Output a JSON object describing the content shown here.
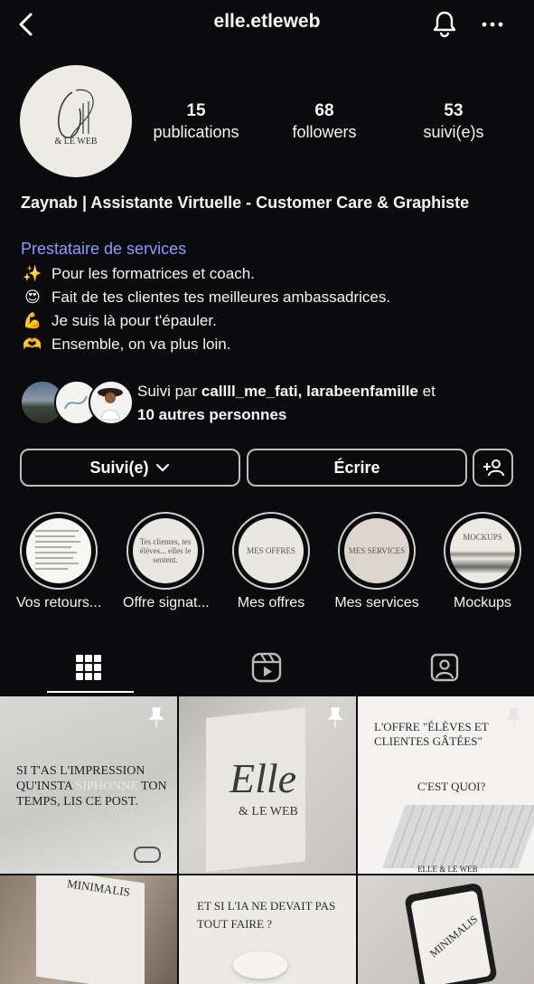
{
  "header": {
    "username": "elle.etleweb"
  },
  "profile": {
    "avatar_logo_text": "Elle",
    "avatar_logo_sub": "& LE WEB",
    "stats": [
      {
        "value": "15",
        "label": "publications"
      },
      {
        "value": "68",
        "label": "followers"
      },
      {
        "value": "53",
        "label": "suivi(e)s"
      }
    ],
    "name": "Zaynab | Assistante Virtuelle - Customer Care & Graphiste",
    "category": "Prestataire de services",
    "bio": [
      {
        "emoji": "✨",
        "text": "Pour les formatrices et coach."
      },
      {
        "emoji": "😍",
        "text": "Fait de tes clientes tes meilleures ambassadrices."
      },
      {
        "emoji": "💪",
        "text": "Je suis là pour t'épauler."
      },
      {
        "emoji": "🫶",
        "text": "Ensemble, on va plus loin."
      }
    ],
    "mutual": {
      "prefix": "Suivi par ",
      "names": "callll_me_fati, larabeenfamille",
      "middle": " et",
      "others": "10 autres personnes"
    }
  },
  "actions": {
    "following_label": "Suivi(e)",
    "message_label": "Écrire"
  },
  "highlights": [
    {
      "label": "Vos retours...",
      "cover": "avis"
    },
    {
      "label": "Offre signat...",
      "cover": "Tes clientes, tes élèves... elles le sentent."
    },
    {
      "label": "Mes offres",
      "cover": "MES OFFRES"
    },
    {
      "label": "Mes services",
      "cover": "MES SERVICES"
    },
    {
      "label": "Mockups",
      "cover": "MOCKUPS"
    }
  ],
  "posts": [
    {
      "text_a": "SI T'AS L'IMPRESSION QU'INSTA ",
      "highlight": "SIPHONNE",
      "text_b": " TON TEMPS, LIS CE POST."
    },
    {
      "logo": "Elle",
      "sub": "& LE WEB"
    },
    {
      "headline": "L'OFFRE \"ÉLÈVES ET CLIENTES GÂTÉES\"",
      "question": "C'EST QUOI?",
      "footer": "ELLE & LE WEB"
    },
    {
      "brand": "MINIMALIS"
    },
    {
      "headline": "ET SI L'IA NE DEVAIT PAS TOUT FAIRE ?"
    },
    {
      "brand": "MINIMALIS"
    }
  ],
  "colors": {
    "background": "#0b0b0d",
    "accent_link": "#8b9bff",
    "highlight_word": "#f3e6d8"
  }
}
